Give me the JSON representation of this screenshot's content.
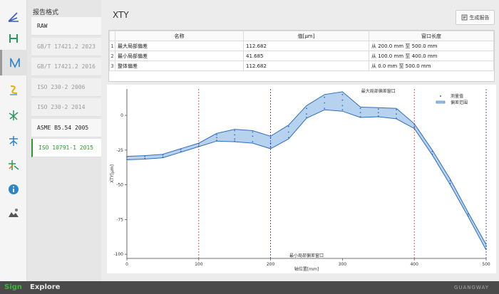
{
  "toolbar": {
    "icons": [
      "angle-icon",
      "straightness-icon",
      "xty-icon",
      "pitch-icon",
      "squareness-icon",
      "parallelism-icon",
      "rotary-icon",
      "info-icon",
      "environment-icon"
    ],
    "active": "xty-icon"
  },
  "formats": {
    "title": "报告格式",
    "items": [
      {
        "label": "RAW",
        "state": "enabled"
      },
      {
        "label": "GB/T 17421.2 2023",
        "state": "disabled"
      },
      {
        "label": "GB/T 17421.2 2016",
        "state": "disabled"
      },
      {
        "label": "ISO 230-2 2006",
        "state": "disabled"
      },
      {
        "label": "ISO 230-2 2014",
        "state": "disabled"
      },
      {
        "label": "ASME B5.54 2005",
        "state": "enabled"
      },
      {
        "label": "ISO 10791-1 2015",
        "state": "selected"
      }
    ]
  },
  "main": {
    "title": "XTY",
    "report_button": "生成报告"
  },
  "table": {
    "headers": [
      "名称",
      "值[μm]",
      "窗口长度"
    ],
    "rows": [
      {
        "num": "1",
        "name": "最大局部偏差",
        "value": "112.682",
        "window": "从 200.0 mm 至 500.0 mm"
      },
      {
        "num": "2",
        "name": "最小局部偏差",
        "value": "41.685",
        "window": "从 100.0 mm 至 400.0 mm"
      },
      {
        "num": "3",
        "name": "整体偏差",
        "value": "112.682",
        "window": "从 0.0 mm 至 500.0 mm"
      }
    ]
  },
  "chart_data": {
    "type": "area",
    "xlabel": "轴位置[mm]",
    "ylabel": "XTY[μm]",
    "xlim": [
      0,
      500
    ],
    "ylim": [
      -103,
      19
    ],
    "xticks": [
      0,
      100,
      200,
      300,
      400,
      500
    ],
    "yticks": [
      0,
      -25,
      -50,
      -75,
      -100
    ],
    "x": [
      0,
      25,
      50,
      75,
      100,
      125,
      150,
      175,
      200,
      225,
      250,
      275,
      300,
      325,
      350,
      375,
      400,
      425,
      450,
      475,
      500
    ],
    "series": [
      {
        "name": "偏差范围",
        "upper": [
          -29.5,
          -29,
          -28,
          -24,
          -20,
          -13,
          -10,
          -11,
          -15,
          -7,
          7,
          15,
          17,
          6,
          5.5,
          5,
          -6,
          -25,
          -46,
          -70,
          -93
        ],
        "lower": [
          -32,
          -31.5,
          -30.5,
          -26.5,
          -22.5,
          -18.5,
          -19,
          -20,
          -24,
          -17,
          -2,
          4,
          3,
          -1.5,
          -1,
          -2.5,
          -9.5,
          -28.5,
          -50,
          -73,
          -97
        ],
        "color": "#2e6fbf"
      },
      {
        "name": "测量值",
        "color": "#2e6fbf"
      }
    ],
    "measured": [
      [
        [
          0,
          -30
        ],
        [
          0,
          -31.5
        ]
      ],
      [
        [
          25,
          -29.5
        ],
        [
          25,
          -31
        ]
      ],
      [
        [
          50,
          -28.5
        ],
        [
          50,
          -30
        ]
      ],
      [
        [
          75,
          -24.5
        ],
        [
          75,
          -26
        ]
      ],
      [
        [
          100,
          -20.5
        ],
        [
          100,
          -22
        ]
      ],
      [
        [
          125,
          -14
        ],
        [
          125,
          -16
        ],
        [
          125,
          -18
        ]
      ],
      [
        [
          150,
          -11
        ],
        [
          150,
          -14
        ],
        [
          150,
          -17
        ],
        [
          150,
          -18.5
        ]
      ],
      [
        [
          175,
          -12
        ],
        [
          175,
          -15
        ],
        [
          175,
          -19
        ]
      ],
      [
        [
          200,
          -16
        ],
        [
          200,
          -20
        ],
        [
          200,
          -23
        ]
      ],
      [
        [
          225,
          -8
        ],
        [
          225,
          -12
        ],
        [
          225,
          -16
        ]
      ],
      [
        [
          250,
          5
        ],
        [
          250,
          1
        ],
        [
          250,
          -1.5
        ]
      ],
      [
        [
          275,
          13
        ],
        [
          275,
          9
        ],
        [
          275,
          5
        ]
      ],
      [
        [
          300,
          15
        ],
        [
          300,
          11
        ],
        [
          300,
          7
        ],
        [
          300,
          4
        ]
      ],
      [
        [
          325,
          5
        ],
        [
          325,
          2
        ],
        [
          325,
          -1
        ]
      ],
      [
        [
          350,
          4.5
        ],
        [
          350,
          2
        ],
        [
          350,
          -0.5
        ]
      ],
      [
        [
          375,
          4
        ],
        [
          375,
          1
        ],
        [
          375,
          -2
        ]
      ],
      [
        [
          400,
          -6.5
        ],
        [
          400,
          -8
        ],
        [
          400,
          -9
        ]
      ],
      [
        [
          425,
          -26
        ],
        [
          425,
          -28
        ]
      ],
      [
        [
          450,
          -47
        ],
        [
          450,
          -49
        ]
      ],
      [
        [
          475,
          -71
        ],
        [
          475,
          -72.5
        ]
      ],
      [
        [
          500,
          -94
        ],
        [
          500,
          -96
        ]
      ]
    ],
    "windows": [
      {
        "label": "最大局部偏差窗口",
        "from": 200,
        "to": 500,
        "color": "#2b2bd9",
        "label_at": 350,
        "label_pos": "top"
      },
      {
        "label": "最小局部偏差窗口",
        "from": 100,
        "to": 400,
        "color": "#d92b2b",
        "label_at": 250,
        "label_pos": "bottom"
      }
    ],
    "legend": {
      "position": "top-right"
    },
    "grid": false
  },
  "bottom": {
    "brand_sign": "Sign",
    "brand_app": "Explore",
    "company": "GUANGWAY"
  }
}
